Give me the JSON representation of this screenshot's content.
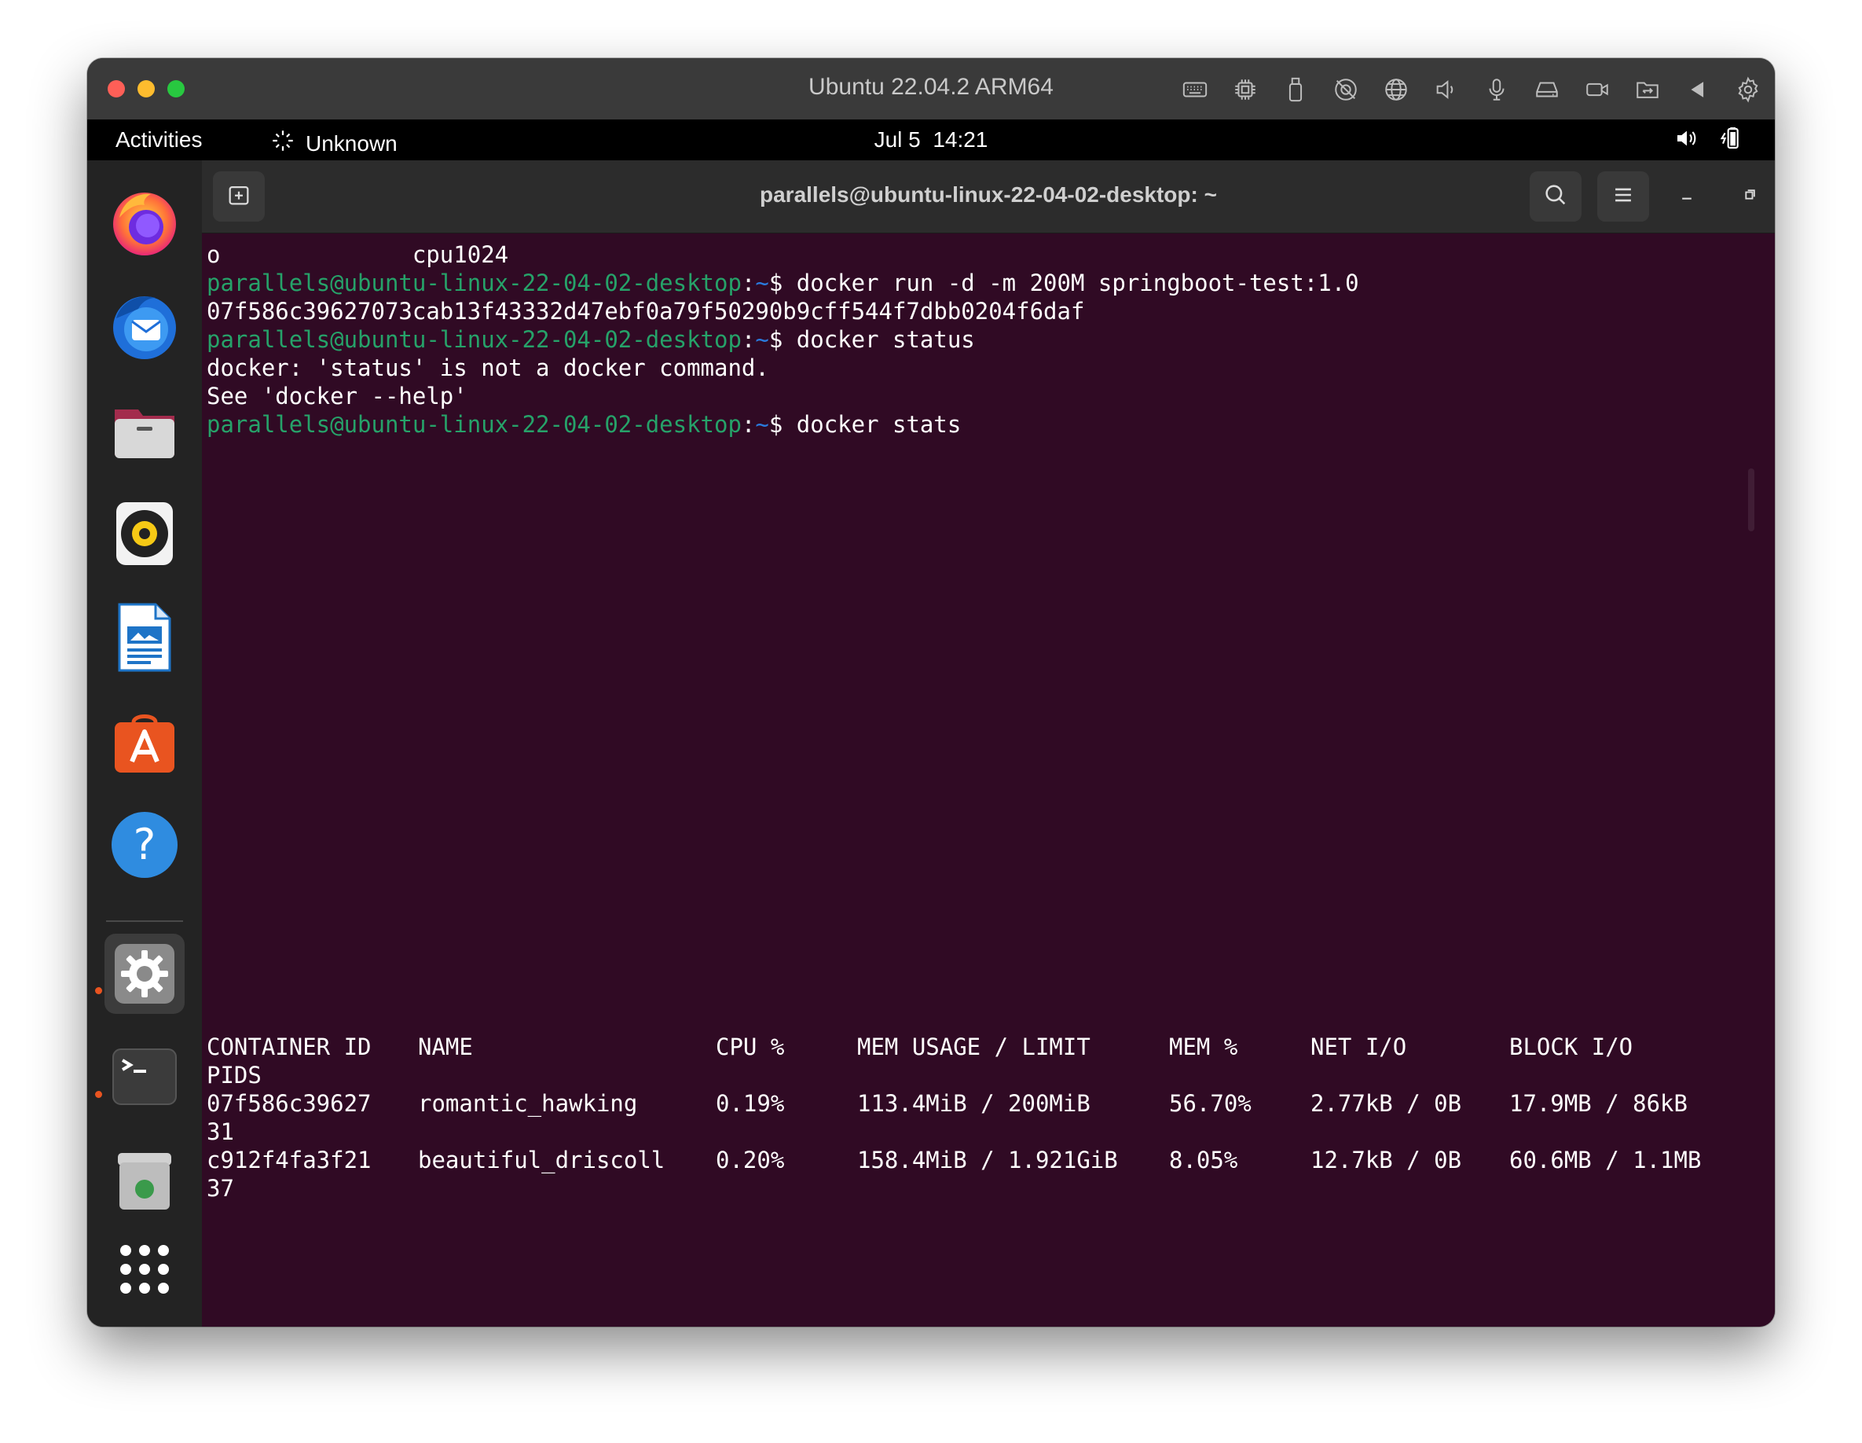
{
  "vm_window": {
    "title": "Ubuntu 22.04.2 ARM64",
    "toolbar_icons": [
      "keyboard-icon",
      "cpu-icon",
      "usb-icon",
      "camera-off-icon",
      "network-globe-icon",
      "volume-icon",
      "microphone-icon",
      "disk-drive-icon",
      "video-camera-icon",
      "shared-folder-icon",
      "arrow-left-icon",
      "gear-icon"
    ]
  },
  "top_bar": {
    "activities": "Activities",
    "app_name": "Unknown",
    "date": "Jul 5",
    "time": "14:21"
  },
  "dock": {
    "items": [
      "firefox",
      "thunderbird",
      "files",
      "rhythmbox",
      "libreoffice-writer",
      "app-center",
      "help",
      "settings",
      "terminal",
      "trash",
      "show-apps"
    ],
    "accent": "#e95420"
  },
  "terminal": {
    "title": "parallels@ubuntu-linux-22-04-02-desktop: ~",
    "background": "#300a24",
    "prompt_user": "parallels@ubuntu-linux-22-04-02-desktop",
    "prompt_sep": ":",
    "prompt_path": "~",
    "prompt_char": "$",
    "line0": "o              cpu1024",
    "cmd1": " docker run -d -m 200M springboot-test:1.0",
    "out1": "07f586c39627073cab13f43332d47ebf0a79f50290b9cff544f7dbb0204f6daf",
    "cmd2": " docker status",
    "out2a": "docker: 'status' is not a docker command.",
    "out2b": "See 'docker --help'",
    "cmd3": " docker stats",
    "stats": {
      "headers": [
        "CONTAINER ID",
        "NAME",
        "CPU %",
        "MEM USAGE / LIMIT",
        "MEM %",
        "NET I/O",
        "BLOCK I/O",
        "PIDS"
      ],
      "rows": [
        {
          "id": "07f586c39627",
          "name": "romantic_hawking",
          "cpu": "0.19%",
          "mem_usage": "113.4MiB / 200MiB",
          "mem_pct": "56.70%",
          "net": "2.77kB / 0B",
          "block": "17.9MB / 86kB",
          "pids": "31"
        },
        {
          "id": "c912f4fa3f21",
          "name": "beautiful_driscoll",
          "cpu": "0.20%",
          "mem_usage": "158.4MiB / 1.921GiB",
          "mem_pct": "8.05%",
          "net": "12.7kB / 0B",
          "block": "60.6MB / 1.1MB",
          "pids": "37"
        }
      ]
    }
  }
}
